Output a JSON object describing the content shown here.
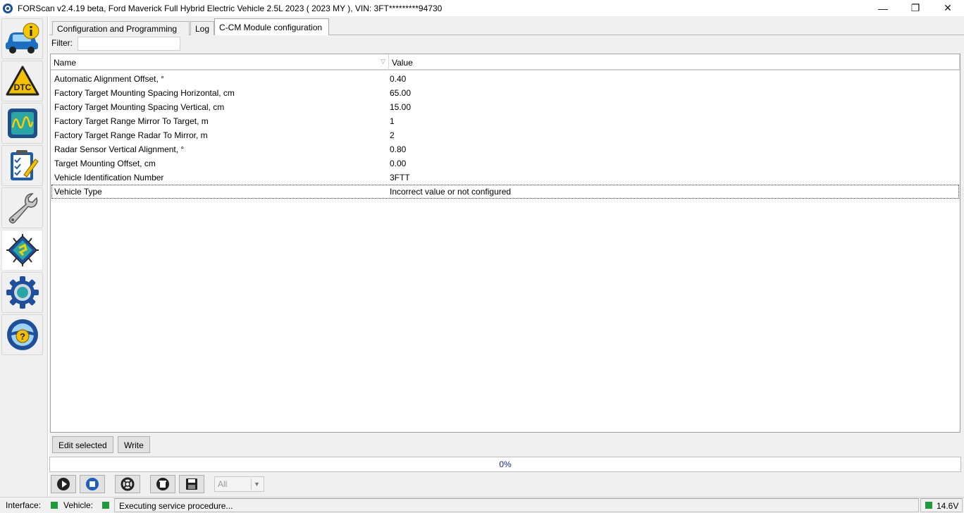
{
  "window": {
    "title": "FORScan v2.4.19 beta, Ford Maverick Full Hybrid Electric Vehicle 2.5L 2023 ( 2023 MY ), VIN: 3FT*********94730",
    "minimize": "—",
    "restore": "❐",
    "close": "✕"
  },
  "sidebar": {
    "items": [
      {
        "name": "vehicle-info",
        "icon": "car-info-icon"
      },
      {
        "name": "dtc",
        "icon": "dtc-warning-icon",
        "label": "DTC"
      },
      {
        "name": "oscilloscope",
        "icon": "oscilloscope-icon"
      },
      {
        "name": "tests",
        "icon": "checklist-icon"
      },
      {
        "name": "service",
        "icon": "wrench-icon"
      },
      {
        "name": "configuration",
        "icon": "chip-icon"
      },
      {
        "name": "settings",
        "icon": "gear-icon"
      },
      {
        "name": "help",
        "icon": "help-wheel-icon"
      }
    ]
  },
  "tabs": [
    {
      "label": "Configuration and Programming"
    },
    {
      "label": "Log"
    },
    {
      "label": "C-CM Module configuration"
    }
  ],
  "filter": {
    "label": "Filter:",
    "value": ""
  },
  "grid": {
    "columns": [
      "Name",
      "Value"
    ],
    "rows": [
      {
        "name": "Automatic Alignment Offset, °",
        "value": "0.40"
      },
      {
        "name": "Factory Target Mounting Spacing Horizontal, cm",
        "value": "65.00"
      },
      {
        "name": "Factory Target Mounting Spacing Vertical, cm",
        "value": "15.00"
      },
      {
        "name": "Factory Target Range Mirror To Target, m",
        "value": "1"
      },
      {
        "name": "Factory Target Range Radar To Mirror, m",
        "value": "2"
      },
      {
        "name": "Radar Sensor Vertical Alignment, °",
        "value": "0.80"
      },
      {
        "name": "Target Mounting Offset, cm",
        "value": "0.00"
      },
      {
        "name": "Vehicle Identification Number",
        "value": "3FTT"
      },
      {
        "name": "Vehicle Type",
        "value": "Incorrect value or not configured"
      }
    ],
    "selected_row": 8
  },
  "actions": {
    "edit_selected": "Edit selected",
    "write": "Write"
  },
  "progress": {
    "text": "0%",
    "value": 0
  },
  "toolbar": {
    "buttons": [
      "play-icon",
      "stop-icon",
      "lifebuoy-icon",
      "clear-icon",
      "save-icon"
    ],
    "select_value": "All"
  },
  "status": {
    "interface_label": "Interface:",
    "vehicle_label": "Vehicle:",
    "message": "Executing service procedure...",
    "voltage": "14.6V",
    "led_color": "#1f9a3c"
  }
}
